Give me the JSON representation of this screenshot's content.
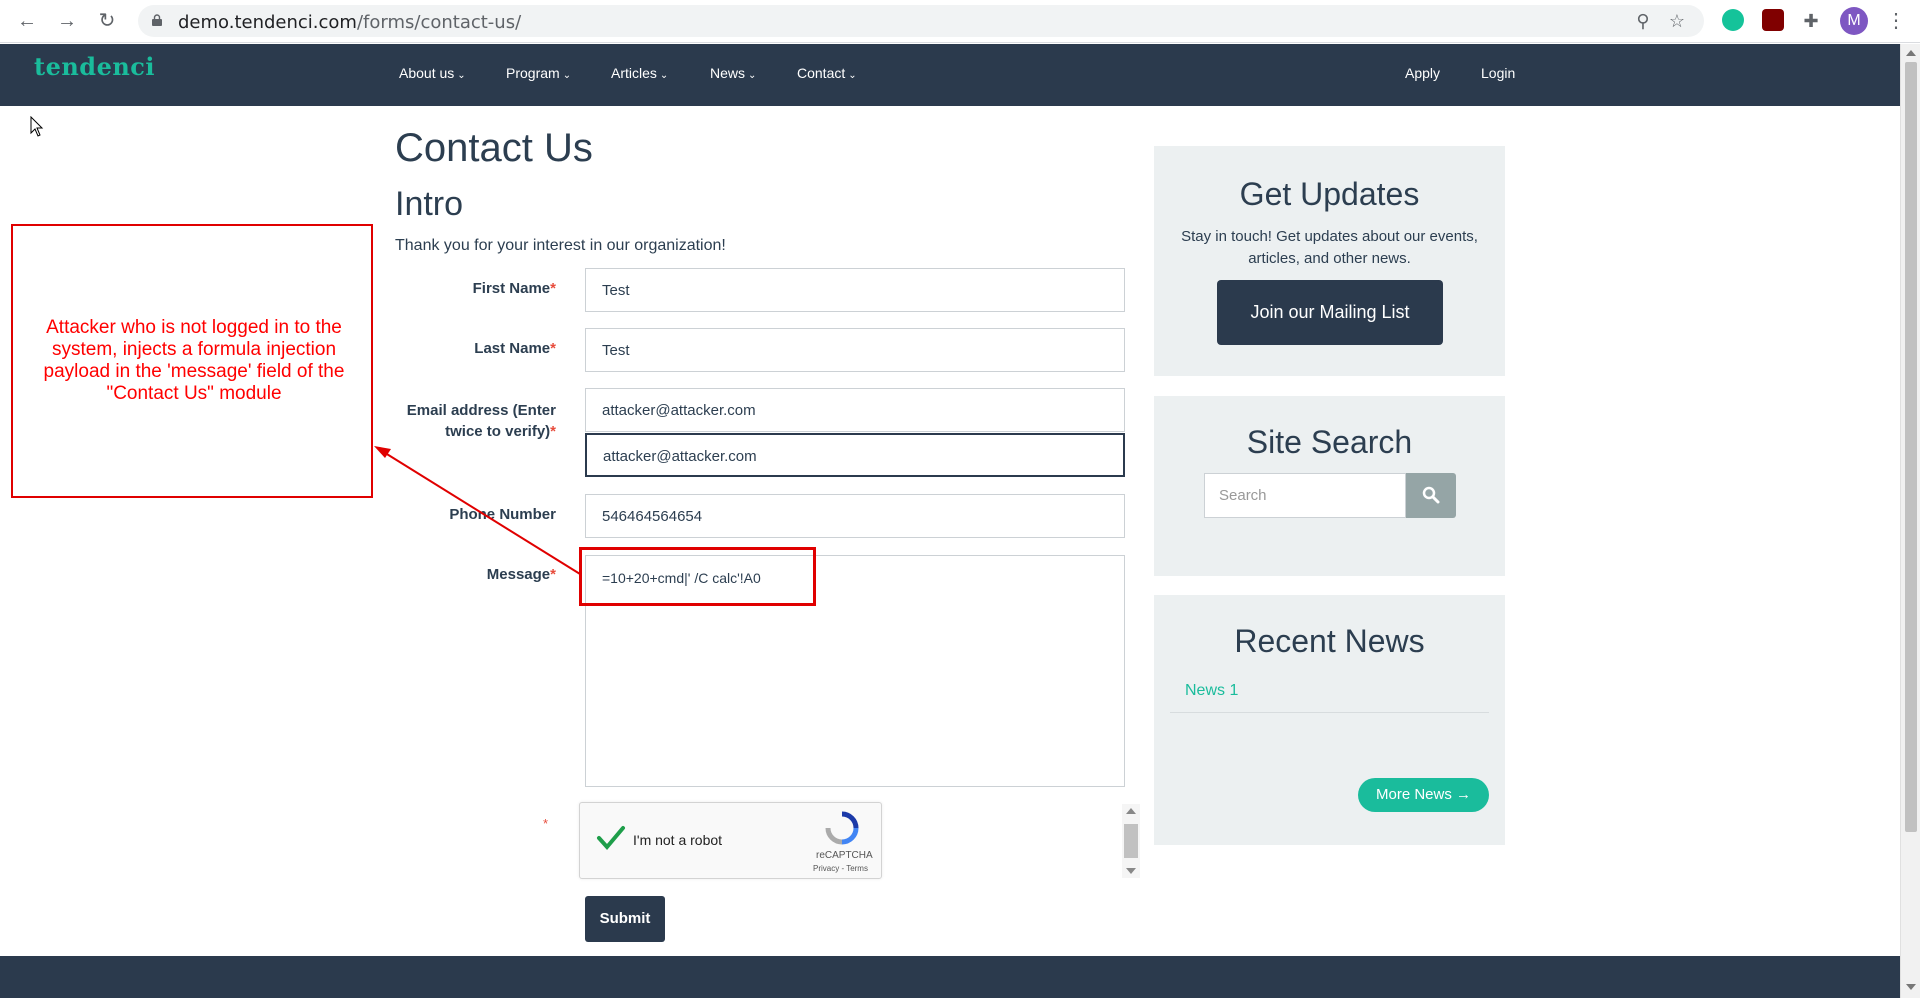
{
  "browser": {
    "url_host": "demo.tendenci.com",
    "url_path": "/forms/contact-us/",
    "avatar_letter": "M",
    "accent_colors": {
      "grammarly": "#15c39a",
      "ublock": "#800000"
    }
  },
  "nav": {
    "logo": "tendenci",
    "menu": [
      {
        "label": "About us"
      },
      {
        "label": "Program"
      },
      {
        "label": "Articles"
      },
      {
        "label": "News"
      },
      {
        "label": "Contact"
      }
    ],
    "apply": "Apply",
    "login": "Login"
  },
  "page": {
    "title": "Contact Us",
    "section": "Intro",
    "intro": "Thank you for your interest in our organization!"
  },
  "form": {
    "first_name": {
      "label": "First Name",
      "value": "Test"
    },
    "last_name": {
      "label": "Last Name",
      "value": "Test"
    },
    "email": {
      "label_line1": "Email address (Enter",
      "label_line2": "twice to verify)",
      "value": "attacker@attacker.com",
      "confirm_value": "attacker@attacker.com"
    },
    "phone": {
      "label": "Phone Number",
      "value": "546464564654"
    },
    "message": {
      "label": "Message",
      "value": "=10+20+cmd|' /C calc'!A0"
    },
    "required_mark": "*",
    "recaptcha": {
      "label": "I'm not a robot",
      "brand": "reCAPTCHA",
      "terms": "Privacy - Terms"
    },
    "submit": "Submit"
  },
  "sidebar": {
    "updates": {
      "title": "Get Updates",
      "text": "Stay in touch! Get updates about our events, articles, and other news.",
      "button": "Join our Mailing List"
    },
    "search": {
      "title": "Site Search",
      "placeholder": "Search"
    },
    "news": {
      "title": "Recent News",
      "items": [
        "News 1"
      ],
      "more": "More News →"
    }
  },
  "annotation": {
    "text": "Attacker who is not logged in to the system, injects a formula injection payload in the 'message' field of the \"Contact Us\" module",
    "color": "#ff0000"
  },
  "colors": {
    "navbar": "#2b3a4d",
    "accent": "#1abc9c",
    "sidebar_bg": "#ecf0f1",
    "required": "#e74c3c"
  }
}
